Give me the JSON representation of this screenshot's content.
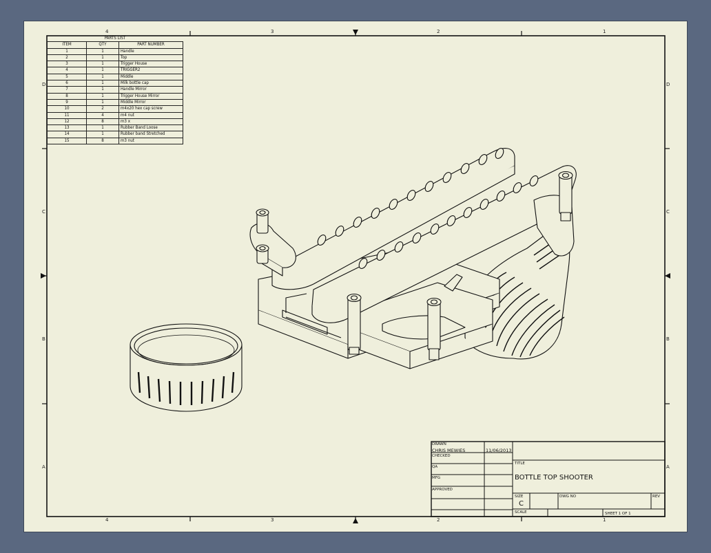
{
  "parts_list": {
    "caption": "PARTS LIST",
    "headers": [
      "ITEM",
      "QTY",
      "PART NUMBER"
    ],
    "rows": [
      [
        "1",
        "1",
        "Handle"
      ],
      [
        "2",
        "1",
        "Top"
      ],
      [
        "3",
        "1",
        "Trigger House"
      ],
      [
        "4",
        "1",
        "TRIGGER2"
      ],
      [
        "5",
        "1",
        "Middle"
      ],
      [
        "6",
        "1",
        "Milk bottle cap"
      ],
      [
        "7",
        "1",
        "Handle Mirror"
      ],
      [
        "8",
        "1",
        "Trigger House Mirror"
      ],
      [
        "9",
        "1",
        "Middle Mirror"
      ],
      [
        "10",
        "2",
        "m4x20 hex cap screw"
      ],
      [
        "11",
        "4",
        "m4 nut"
      ],
      [
        "12",
        "8",
        "m3 x"
      ],
      [
        "13",
        "1",
        "Rubber Band Loose"
      ],
      [
        "14",
        "1",
        "Rubber band Stretched"
      ],
      [
        "15",
        "8",
        "m3 nut"
      ]
    ]
  },
  "zones": {
    "columns": [
      "4",
      "3",
      "2",
      "1"
    ],
    "rows": [
      "D",
      "C",
      "B",
      "A"
    ]
  },
  "title_block": {
    "drawn_label": "DRAWN",
    "drawn_by": "CHRIS MEWIES",
    "drawn_date": "11/06/2013",
    "checked_label": "CHECKED",
    "qa_label": "QA",
    "mfg_label": "MFG",
    "approved_label": "APPROVED",
    "title_label": "TITLE",
    "title": "BOTTLE TOP SHOOTER",
    "size_label": "SIZE",
    "size": "C",
    "dwg_no_label": "DWG NO",
    "rev_label": "REV",
    "scale_label": "SCALE",
    "sheet": "SHEET 1  OF 1"
  },
  "colors": {
    "background": "#5a6880",
    "paper": "#efefdc",
    "line": "#111111"
  }
}
